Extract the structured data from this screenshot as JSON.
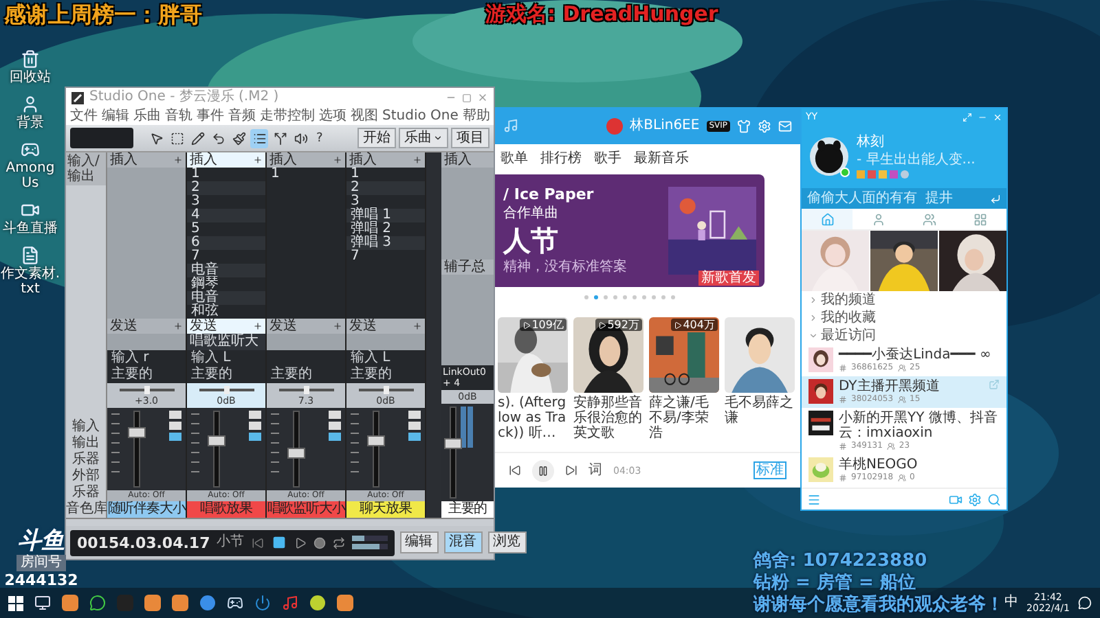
{
  "overlays": {
    "thanks": "感谢上周榜一：胖哥",
    "game": "游戏名: DreadHunger",
    "info_lines": [
      "鸽舍: 1074223880",
      "钻粉 = 房管 = 船位",
      "谢谢每个愿意看我的观众老爷！"
    ],
    "logo": "斗鱼",
    "room_label": "房间号",
    "room_number": "2444132"
  },
  "desktop_icons": [
    {
      "label": "回收站",
      "kind": "bin"
    },
    {
      "label": "背景",
      "kind": "person"
    },
    {
      "label": "Among Us",
      "kind": "game"
    },
    {
      "label": "斗鱼直播",
      "kind": "app"
    },
    {
      "label": "作文素材.txt",
      "kind": "file"
    }
  ],
  "studio": {
    "title": "Studio One - 梦云漫乐 (.M2 )",
    "menu": [
      "文件",
      "编辑",
      "乐曲",
      "音轨",
      "事件",
      "音频",
      "走带控制",
      "选项",
      "视图",
      "Studio One",
      "帮助"
    ],
    "tools": [
      {
        "kind": "arrow",
        "selected": false
      },
      {
        "kind": "range",
        "selected": false
      },
      {
        "kind": "pencil",
        "selected": false
      },
      {
        "kind": "bend",
        "selected": false
      },
      {
        "kind": "brush",
        "selected": false
      },
      {
        "kind": "list",
        "selected": true
      },
      {
        "kind": "split",
        "selected": false
      },
      {
        "kind": "speaker",
        "selected": false
      }
    ],
    "help": "?",
    "pages": [
      {
        "label": "开始",
        "dropdown": false
      },
      {
        "label": "乐曲",
        "dropdown": true
      },
      {
        "label": "项目",
        "dropdown": false
      }
    ],
    "io_header": "输入/输出",
    "left_labels": [
      "输入",
      "输出",
      "乐器",
      "外部",
      "乐器",
      "音色库"
    ],
    "channels": [
      {
        "name": "随听伴奏大小",
        "color": "#8ec8f0",
        "selected": false,
        "insert_label": "插入",
        "send_label": "发送",
        "input": "输入 r",
        "output": "主要的",
        "volume": "+3.0",
        "level": 0.72,
        "auto": "Auto: Off"
      },
      {
        "name": "唱歌放果",
        "color": "#f04848",
        "selected": true,
        "insert_label": "插入",
        "slots": [
          "1",
          "2",
          "3",
          "4",
          "5",
          "6",
          "7",
          "电音",
          "鋼琴",
          "电音",
          "和弦"
        ],
        "send_label": "发送",
        "sends": [
          "唱歌监听大"
        ],
        "input": "输入 L",
        "output": "主要的",
        "volume": "0dB",
        "level": 0.62,
        "auto": "Auto: Off"
      },
      {
        "name": "唱歌监听大小",
        "color": "#f04848",
        "selected": false,
        "insert_label": "插入",
        "slots": [
          "1"
        ],
        "send_label": "发送",
        "output": "主要的",
        "volume": "7.3",
        "level": 0.45,
        "auto": "Auto: Off"
      },
      {
        "name": "聊天放果",
        "color": "#f0e848",
        "selected": false,
        "insert_label": "插入",
        "slots": [
          "1",
          "2",
          "3",
          "弹唱 1",
          "弹唱 2",
          "弹唱 3",
          "7"
        ],
        "send_label": "发送",
        "input": "输入 L",
        "output": "主要的",
        "volume": "0dB",
        "level": 0.62,
        "auto": "Auto: Off"
      }
    ],
    "master": {
      "insert_label": "插入",
      "bus_label": "辅子总",
      "output": "LinkOut0 + 4",
      "volume": "0dB",
      "level": 0.6,
      "name": "主要的"
    },
    "transport": {
      "time": "00154.03.04.17",
      "unit": "小节"
    },
    "views": [
      {
        "label": "编辑",
        "selected": false
      },
      {
        "label": "混音",
        "selected": true
      },
      {
        "label": "浏览",
        "selected": false
      }
    ]
  },
  "music": {
    "user": "林BLin6EE",
    "badge": "SVIP",
    "nav": [
      "歌单",
      "排行榜",
      "歌手",
      "最新音乐"
    ],
    "banner": {
      "title": "/ Ice Paper",
      "subtitle": "合作单曲",
      "headline": "人节",
      "caption": "精神，没有标准答案",
      "tag": "新歌首发",
      "dots": [
        {
          "selected": false
        },
        {
          "selected": true
        },
        {
          "selected": false
        },
        {
          "selected": false
        },
        {
          "selected": false
        },
        {
          "selected": false
        },
        {
          "selected": false
        },
        {
          "selected": false
        },
        {
          "selected": false
        },
        {
          "selected": false
        }
      ]
    },
    "cards": [
      {
        "plays": "109亿",
        "title": "s). (Afterglow as Track)) 听…"
      },
      {
        "plays": "592万",
        "title": "安静那些音乐很治愈的英文歌"
      },
      {
        "plays": "404万",
        "title": "薛之谦/毛不易/李荣浩"
      },
      {
        "title": "毛不易薛之谦"
      }
    ],
    "player": {
      "lyric": "词",
      "quality": "标准",
      "time": "04:03"
    }
  },
  "yy": {
    "title": "YY",
    "name": "林刻",
    "signature": "- 早生出出能人变...",
    "notice": "偷偷大人面的有有",
    "notice_link": "提井",
    "tabs": [
      {
        "kind": "home",
        "selected": true
      },
      {
        "kind": "person",
        "selected": false
      },
      {
        "kind": "contacts",
        "selected": false
      },
      {
        "kind": "apps",
        "selected": false
      }
    ],
    "groups": [
      {
        "label": "我的频道",
        "expanded": false
      },
      {
        "label": "我的收藏",
        "expanded": false
      },
      {
        "label": "最近访问",
        "expanded": true,
        "children": [
          {
            "name": "━━━━小蚕达Linda━━━ ∞",
            "id": "36861625",
            "count": "25",
            "selected": false
          },
          {
            "name": "DY主播开黑频道",
            "id": "38024053",
            "count": "15",
            "selected": true
          },
          {
            "name": "小新的开黑YY  微博、抖音云：imxiaoxin",
            "id": "349131",
            "count": "23",
            "selected": false
          },
          {
            "name": "羊桃NEOGO",
            "id": "97102918",
            "count": "0",
            "selected": false
          }
        ]
      }
    ]
  },
  "taskbar": {
    "apps": [
      {
        "kind": "windows"
      },
      {
        "kind": "monitor"
      },
      {
        "kind": "orange"
      },
      {
        "kind": "chat"
      },
      {
        "kind": "penguin"
      },
      {
        "kind": "orange"
      },
      {
        "kind": "orange"
      },
      {
        "kind": "sogou"
      },
      {
        "kind": "steam"
      },
      {
        "kind": "power"
      },
      {
        "kind": "music"
      },
      {
        "kind": "lime"
      },
      {
        "kind": "orange"
      }
    ],
    "ime": "中",
    "time": "21:42",
    "date": "2022/4/1"
  }
}
